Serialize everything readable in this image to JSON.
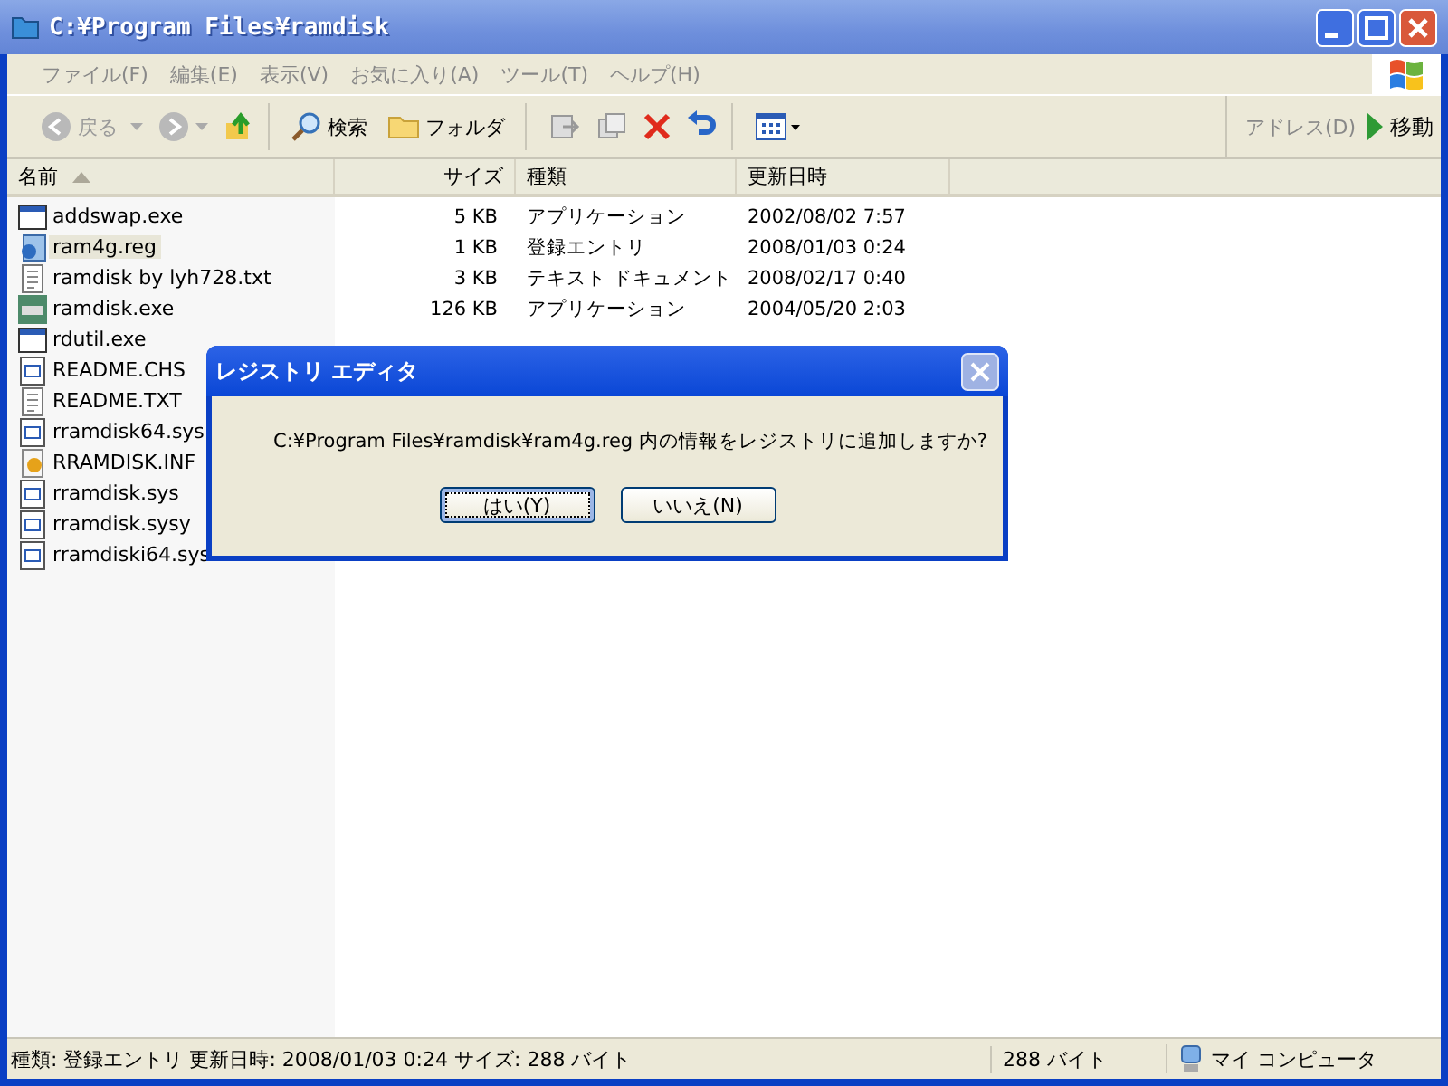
{
  "window": {
    "title": "C:¥Program Files¥ramdisk"
  },
  "menu": [
    "ファイル(F)",
    "編集(E)",
    "表示(V)",
    "お気に入り(A)",
    "ツール(T)",
    "ヘルプ(H)"
  ],
  "toolbar": {
    "back": "戻る",
    "search": "検索",
    "folders": "フォルダ",
    "address": "アドレス(D)",
    "go": "移動"
  },
  "table": {
    "columns": [
      "名前",
      "サイズ",
      "種類",
      "更新日時"
    ],
    "rows": [
      {
        "name": "addswap.exe",
        "kind": "app",
        "size": "5 KB",
        "type": "アプリケーション",
        "date": "2002/08/02 7:57",
        "selected": false
      },
      {
        "name": "ram4g.reg",
        "kind": "reg",
        "size": "1 KB",
        "type": "登録エントリ",
        "date": "2008/01/03 0:24",
        "selected": true
      },
      {
        "name": "ramdisk by lyh728.txt",
        "kind": "txt",
        "size": "3 KB",
        "type": "テキスト ドキュメント",
        "date": "2008/02/17 0:40",
        "selected": false
      },
      {
        "name": "ramdisk.exe",
        "kind": "exe",
        "size": "126 KB",
        "type": "アプリケーション",
        "date": "2004/05/20 2:03",
        "selected": false
      },
      {
        "name": "rdutil.exe",
        "kind": "app",
        "selected": false
      },
      {
        "name": "README.CHS",
        "kind": "sys",
        "selected": false
      },
      {
        "name": "README.TXT",
        "kind": "txt",
        "selected": false
      },
      {
        "name": "rramdisk64.sys",
        "kind": "sys",
        "selected": false
      },
      {
        "name": "RRAMDISK.INF",
        "kind": "inf",
        "selected": false
      },
      {
        "name": "rramdisk.sys",
        "kind": "sys",
        "selected": false
      },
      {
        "name": "rramdisk.sysy",
        "kind": "sys",
        "selected": false
      },
      {
        "name": "rramdiski64.sys",
        "kind": "sys",
        "selected": false
      }
    ]
  },
  "dialog": {
    "title": "レジストリ エディタ",
    "message": "C:¥Program Files¥ramdisk¥ram4g.reg 内の情報をレジストリに追加しますか?",
    "buttons": [
      {
        "label": "はい(Y)",
        "selected": true
      },
      {
        "label": "いいえ(N)",
        "selected": false
      }
    ]
  },
  "status_bar": {
    "info": "種類: 登録エントリ 更新日時: 2008/01/03 0:24 サイズ: 288 バイト",
    "size": "288 バイト",
    "zone": "マイ コンピュータ"
  }
}
